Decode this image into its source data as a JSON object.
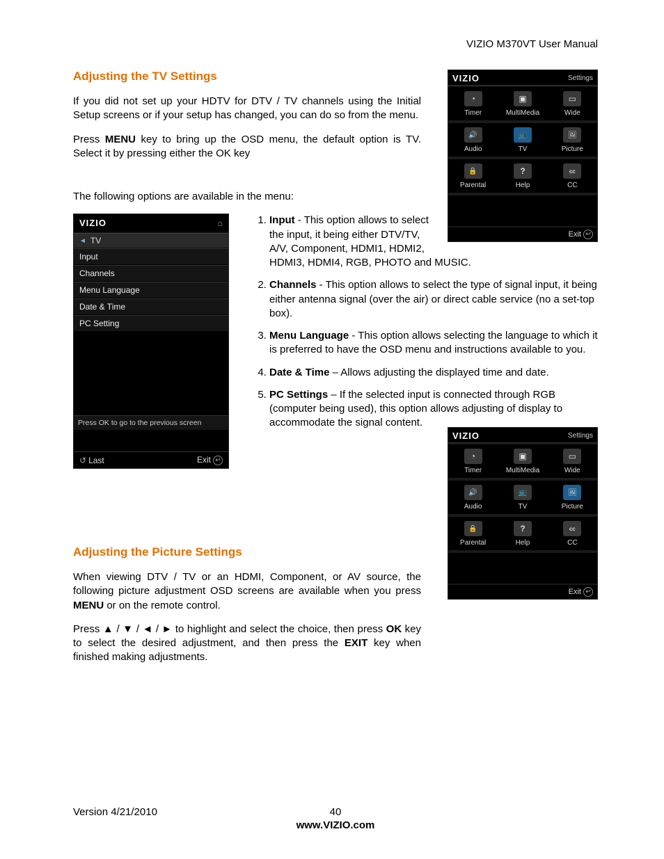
{
  "header": {
    "doc_title": "VIZIO M370VT User Manual"
  },
  "section1": {
    "title": "Adjusting the TV Settings",
    "p1a": "If you did not set up your HDTV for DTV / TV channels using the Initial Setup screens or if your setup has changed, you can do so from the menu.",
    "p2_pre": "Press ",
    "p2_bold": "MENU",
    "p2_post": " key to bring up the OSD menu, the default option is TV. Select it by pressing either the OK key",
    "p3_pre": "The following options are available in the ",
    "p3_post": "    menu:"
  },
  "osd_grid": {
    "brand": "VIZIO",
    "top_label": "Settings",
    "cells": [
      [
        {
          "label": "Timer",
          "icon": "g-timer"
        },
        {
          "label": "MultiMedia",
          "icon": "g-mm"
        },
        {
          "label": "Wide",
          "icon": "g-wide"
        }
      ],
      [
        {
          "label": "Audio",
          "icon": "g-audio"
        },
        {
          "label": "TV",
          "icon": "g-tv",
          "selected": true
        },
        {
          "label": "Picture",
          "icon": "g-pic"
        }
      ],
      [
        {
          "label": "Parental",
          "icon": "g-lock"
        },
        {
          "label": "Help",
          "icon": "g-help"
        },
        {
          "label": "CC",
          "icon": "g-cc"
        }
      ]
    ],
    "exit": "Exit"
  },
  "osd_grid2": {
    "brand": "VIZIO",
    "top_label": "Settings",
    "cells": [
      [
        {
          "label": "Timer",
          "icon": "g-timer"
        },
        {
          "label": "MultiMedia",
          "icon": "g-mm"
        },
        {
          "label": "Wide",
          "icon": "g-wide"
        }
      ],
      [
        {
          "label": "Audio",
          "icon": "g-audio"
        },
        {
          "label": "TV",
          "icon": "g-tv"
        },
        {
          "label": "Picture",
          "icon": "g-pic",
          "selected": true
        }
      ],
      [
        {
          "label": "Parental",
          "icon": "g-lock"
        },
        {
          "label": "Help",
          "icon": "g-help"
        },
        {
          "label": "CC",
          "icon": "g-cc"
        }
      ]
    ],
    "exit": "Exit"
  },
  "osd_list": {
    "brand": "VIZIO",
    "breadcrumb": "TV",
    "items": [
      "Input",
      "Channels",
      "Menu Language",
      "Date & Time",
      "PC Setting"
    ],
    "hint": "Press OK to go to the previous screen",
    "last": "Last",
    "exit": "Exit"
  },
  "options": [
    {
      "bold": "Input",
      "sep": " -  ",
      "text": "This option allows to select the input, it being either DTV/TV, A/V, Component, HDMI1, HDMI2, HDMI3, HDMI4, RGB, PHOTO and MUSIC."
    },
    {
      "bold": "Channels",
      "sep": " - ",
      "text": "This option allows to select the type of signal input, it being either antenna signal (over the air) or direct cable service (no a set-top box)."
    },
    {
      "bold": "Menu Language",
      "sep": " - ",
      "text": "This option allows selecting the language to which it is preferred to have the OSD menu and instructions available to you."
    },
    {
      "bold": "Date & Time",
      "sep": " – ",
      "text": "Allows adjusting the displayed time and date."
    },
    {
      "bold": "PC Settings",
      "sep": " – ",
      "text": "If the selected input is connected through RGB (computer being used), this option allows adjusting of display to accommodate the signal content.",
      "boldnum": true
    }
  ],
  "section2": {
    "title": "Adjusting the Picture Settings",
    "p1_pre": "When viewing DTV / TV or an HDMI, Component, or AV source, the following picture adjustment OSD screens are available when you press ",
    "p1_bold": "MENU",
    "p1_post": " or on the remote control.",
    "p2_a": "Press ",
    "p2_arrows": "▲ / ▼ / ◄ / ►",
    "p2_b": " to highlight and select the choice, then press ",
    "p2_ok": "OK",
    "p2_c": " key to select the desired adjustment, and then press the ",
    "p2_exit": "EXIT",
    "p2_d": " key when finished making adjustments."
  },
  "footer": {
    "version": "Version 4/21/2010",
    "page": "40",
    "url": "www.VIZIO.com"
  }
}
